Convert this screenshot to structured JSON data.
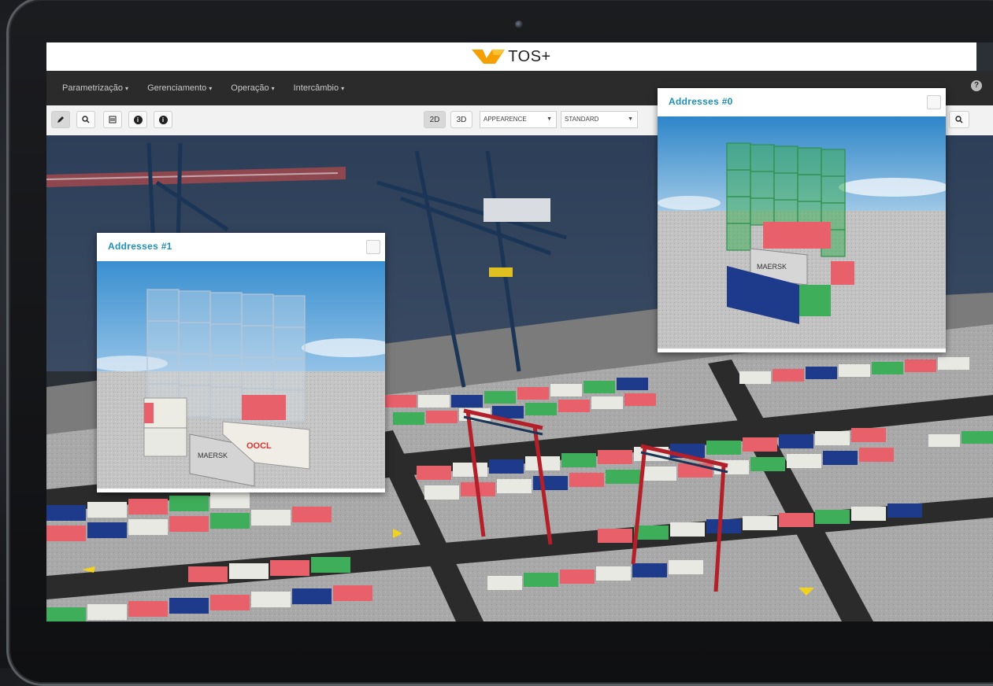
{
  "app": {
    "logo_text": "TOS+",
    "logo_icon": "tos-wing-logo"
  },
  "menu": {
    "items": [
      {
        "label": "Parametrização"
      },
      {
        "label": "Gerenciamento"
      },
      {
        "label": "Operação"
      },
      {
        "label": "Intercâmbio"
      }
    ]
  },
  "toolbar": {
    "tools": [
      "pencil-icon",
      "search-icon",
      "list-icon",
      "info-icon",
      "info-icon"
    ],
    "view_2d": "2D",
    "view_3d": "3D",
    "active_view": "2D",
    "appearance_select": "APPEARENCE",
    "standard_select": "STANDARD"
  },
  "popups": {
    "addresses_0": {
      "title": "Addresses #0",
      "container_label": "MAERSK"
    },
    "addresses_1": {
      "title": "Addresses #1",
      "container_label_1": "MAERSK",
      "container_label_2": "OOCL"
    }
  },
  "colors": {
    "accent": "#1f8fb8",
    "logo_orange": "#f5a000",
    "container_green": "#3fae5a",
    "container_red": "#e8606a",
    "container_blue": "#1e3a8a",
    "container_white": "#e9e9e4",
    "crane_red": "#b3202a",
    "crane_blue": "#1b3556"
  }
}
